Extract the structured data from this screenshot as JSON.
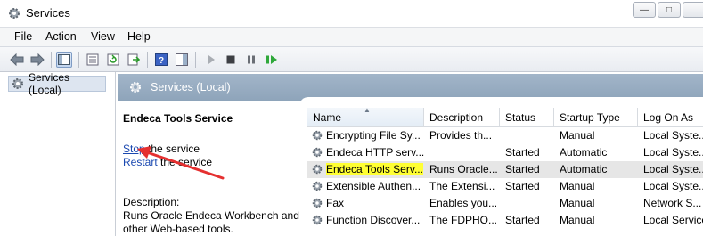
{
  "window": {
    "title": "Services"
  },
  "titlebar_buttons": {
    "minimize": "",
    "maximize": "",
    "close": ""
  },
  "menu": [
    "File",
    "Action",
    "View",
    "Help"
  ],
  "tree": {
    "root_label": "Services (Local)"
  },
  "pane_header": {
    "title": "Services (Local)"
  },
  "extended": {
    "service_title": "Endeca Tools Service",
    "stop_link": "Stop",
    "stop_suffix": " the service",
    "restart_link": "Restart",
    "restart_suffix": " the service",
    "description_label": "Description:",
    "description_text": "Runs Oracle Endeca Workbench and other Web-based tools."
  },
  "table": {
    "columns": [
      "Name",
      "Description",
      "Status",
      "Startup Type",
      "Log On As"
    ],
    "rows": [
      {
        "name": "Encrypting File Sy...",
        "description": "Provides th...",
        "status": "",
        "startup": "Manual",
        "logon": "Local Syste...",
        "selected": false
      },
      {
        "name": "Endeca HTTP serv...",
        "description": "",
        "status": "Started",
        "startup": "Automatic",
        "logon": "Local Syste...",
        "selected": false
      },
      {
        "name": "Endeca Tools Serv...",
        "description": "Runs Oracle...",
        "status": "Started",
        "startup": "Automatic",
        "logon": "Local Syste...",
        "selected": true
      },
      {
        "name": "Extensible Authen...",
        "description": "The Extensi...",
        "status": "Started",
        "startup": "Manual",
        "logon": "Local Syste...",
        "selected": false
      },
      {
        "name": "Fax",
        "description": "Enables you...",
        "status": "",
        "startup": "Manual",
        "logon": "Network S...",
        "selected": false
      },
      {
        "name": "Function Discover...",
        "description": "The FDPHO...",
        "status": "Started",
        "startup": "Manual",
        "logon": "Local Service",
        "selected": false
      }
    ]
  },
  "colors": {
    "highlight": "#ffff33",
    "annotation_arrow": "#e53030",
    "link": "#1a48b0",
    "pane_header": "#97abc0"
  }
}
